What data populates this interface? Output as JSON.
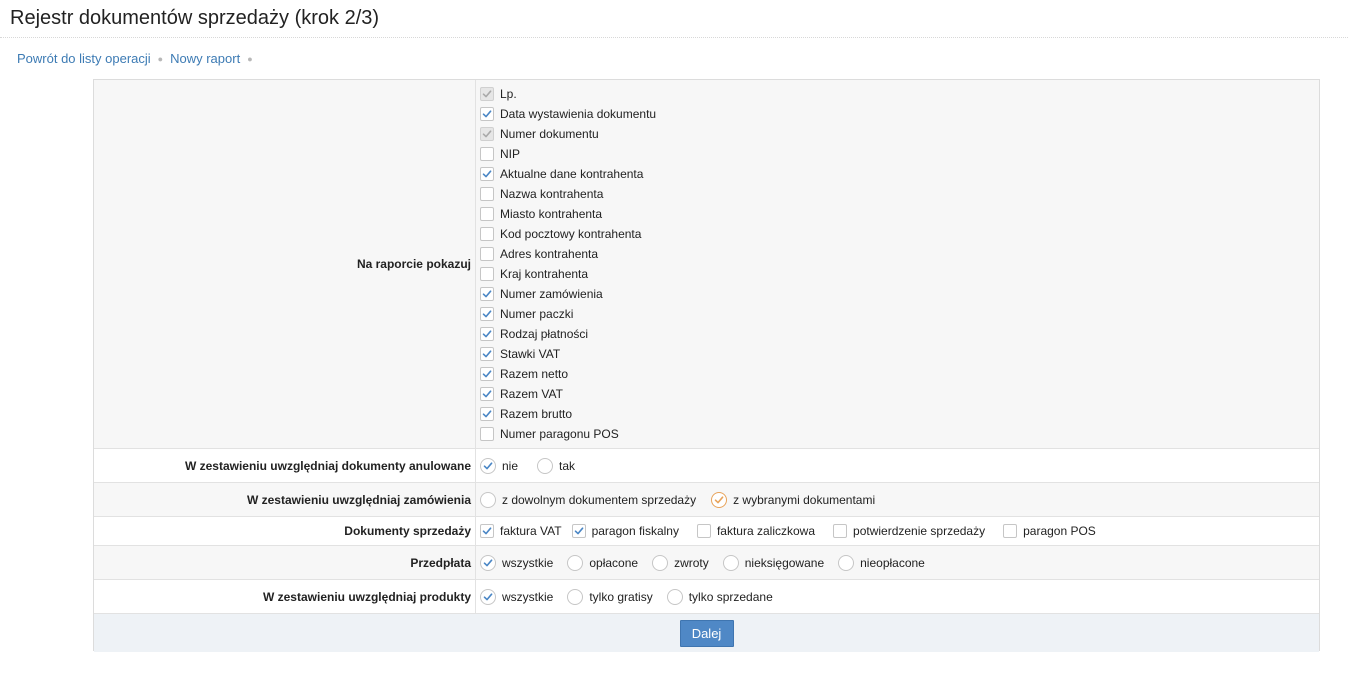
{
  "page": {
    "title": "Rejestr dokumentów sprzedaży (krok 2/3)"
  },
  "breadcrumb": {
    "back": "Powrót do listy operacji",
    "new_report": "Nowy raport"
  },
  "show_on_report": {
    "label": "Na raporcie pokazuj",
    "items": [
      {
        "label": "Lp.",
        "checked": true,
        "disabled": true
      },
      {
        "label": "Data wystawienia dokumentu",
        "checked": true,
        "disabled": false
      },
      {
        "label": "Numer dokumentu",
        "checked": true,
        "disabled": true
      },
      {
        "label": "NIP",
        "checked": false,
        "disabled": false
      },
      {
        "label": "Aktualne dane kontrahenta",
        "checked": true,
        "disabled": false
      },
      {
        "label": "Nazwa kontrahenta",
        "checked": false,
        "disabled": false
      },
      {
        "label": "Miasto kontrahenta",
        "checked": false,
        "disabled": false
      },
      {
        "label": "Kod pocztowy kontrahenta",
        "checked": false,
        "disabled": false
      },
      {
        "label": "Adres kontrahenta",
        "checked": false,
        "disabled": false
      },
      {
        "label": "Kraj kontrahenta",
        "checked": false,
        "disabled": false
      },
      {
        "label": "Numer zamówienia",
        "checked": true,
        "disabled": false
      },
      {
        "label": "Numer paczki",
        "checked": true,
        "disabled": false
      },
      {
        "label": "Rodzaj płatności",
        "checked": true,
        "disabled": false
      },
      {
        "label": "Stawki VAT",
        "checked": true,
        "disabled": false
      },
      {
        "label": "Razem netto",
        "checked": true,
        "disabled": false
      },
      {
        "label": "Razem VAT",
        "checked": true,
        "disabled": false
      },
      {
        "label": "Razem brutto",
        "checked": true,
        "disabled": false
      },
      {
        "label": "Numer paragonu POS",
        "checked": false,
        "disabled": false
      }
    ]
  },
  "cancelled_docs": {
    "label": "W zestawieniu uwzględniaj dokumenty anulowane",
    "options": [
      {
        "label": "nie",
        "selected": true
      },
      {
        "label": "tak",
        "selected": false
      }
    ]
  },
  "orders": {
    "label": "W zestawieniu uwzględniaj zamówienia",
    "options": [
      {
        "label": "z dowolnym dokumentem sprzedaży",
        "selected": false
      },
      {
        "label": "z wybranymi dokumentami",
        "selected": true
      }
    ]
  },
  "sales_docs": {
    "label": "Dokumenty sprzedaży",
    "options": [
      {
        "label": "faktura VAT",
        "checked": true
      },
      {
        "label": "paragon fiskalny",
        "checked": true
      },
      {
        "label": "faktura zaliczkowa",
        "checked": false
      },
      {
        "label": "potwierdzenie sprzedaży",
        "checked": false
      },
      {
        "label": "paragon POS",
        "checked": false
      }
    ]
  },
  "prepayment": {
    "label": "Przedpłata",
    "options": [
      {
        "label": "wszystkie",
        "selected": true
      },
      {
        "label": "opłacone",
        "selected": false
      },
      {
        "label": "zwroty",
        "selected": false
      },
      {
        "label": "nieksięgowane",
        "selected": false
      },
      {
        "label": "nieopłacone",
        "selected": false
      }
    ]
  },
  "products": {
    "label": "W zestawieniu uwzględniaj produkty",
    "options": [
      {
        "label": "wszystkie",
        "selected": true
      },
      {
        "label": "tylko gratisy",
        "selected": false
      },
      {
        "label": "tylko sprzedane",
        "selected": false
      }
    ]
  },
  "footer": {
    "next_label": "Dalej"
  },
  "colors": {
    "accent": "#4f88c6",
    "link": "#3d7bb4",
    "check": "#4a86c5",
    "radio_alt": "#e8a35a"
  }
}
